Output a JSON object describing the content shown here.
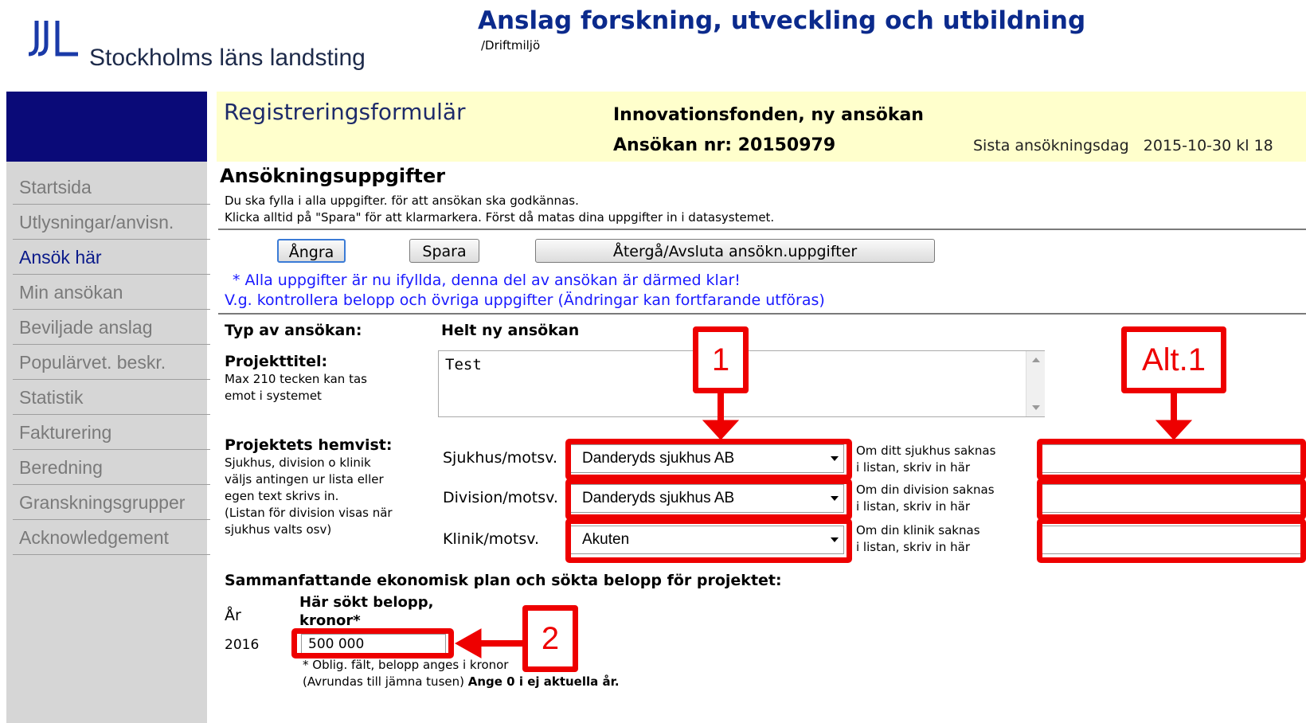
{
  "header": {
    "org_name": "Stockholms läns landsting",
    "app_title": "Anslag forskning, utveckling och utbildning",
    "environment": "/Driftmiljö"
  },
  "sidebar": {
    "items": [
      {
        "label": "Startsida"
      },
      {
        "label": "Utlysningar/anvisn."
      },
      {
        "label": "Ansök här",
        "active": true
      },
      {
        "label": "Min ansökan"
      },
      {
        "label": "Beviljade anslag"
      },
      {
        "label": "Populärvet. beskr."
      },
      {
        "label": "Statistik"
      },
      {
        "label": "Fakturering"
      },
      {
        "label": "Beredning"
      },
      {
        "label": "Granskningsgrupper"
      },
      {
        "label": "Acknowledgement"
      }
    ]
  },
  "band": {
    "form_title": "Registreringsformulär",
    "fund": "Innovationsfonden, ny ansökan",
    "application_nr": "Ansökan nr: 20150979",
    "deadline": "Sista ansökningsdag   2015-10-30 kl 18"
  },
  "section": {
    "title": "Ansökningsuppgifter",
    "instruction_1": "Du ska fylla i alla uppgifter. för att ansökan ska godkännas.",
    "instruction_2": "Klicka alltid på \"Spara\" för att klarmarkera. Först då matas dina uppgifter in i datasystemet."
  },
  "buttons": {
    "undo": "Ångra",
    "save": "Spara",
    "back": "Återgå/Avsluta ansökn.uppgifter"
  },
  "status": {
    "line_1": "* Alla uppgifter är nu ifyllda, denna del av ansökan är därmed klar!",
    "line_2": "V.g. kontrollera belopp och övriga uppgifter (Ändringar kan fortfarande utföras)"
  },
  "form": {
    "type_label": "Typ av ansökan:",
    "type_value": "Helt ny ansökan",
    "title_label": "Projekttitel:",
    "title_hint_1": "Max 210 tecken kan tas",
    "title_hint_2": "emot i systemet",
    "title_value": "Test",
    "home_label": "Projektets hemvist:",
    "home_hint_1": "Sjukhus, division o klinik",
    "home_hint_2": "väljs antingen ur lista eller",
    "home_hint_3": "egen text skrivs in.",
    "home_hint_4": "(Listan för division visas när",
    "home_hint_5": "sjukhus valts osv)",
    "hospital_label": "Sjukhus/motsv.",
    "hospital_value": "Danderyds sjukhus AB",
    "hospital_hint_1": "Om ditt sjukhus saknas",
    "hospital_hint_2": "i listan, skriv in här",
    "division_label": "Division/motsv.",
    "division_value": "Danderyds sjukhus AB",
    "division_hint_1": "Om din division saknas",
    "division_hint_2": "i listan, skriv in här",
    "clinic_label": "Klinik/motsv.",
    "clinic_value": "Akuten",
    "clinic_hint_1": "Om din klinik saknas",
    "clinic_hint_2": "i listan, skriv in här"
  },
  "economy": {
    "title": "Sammanfattande ekonomisk plan och sökta belopp för projektet:",
    "year_header": "År",
    "amount_header_1": "Här sökt belopp,",
    "amount_header_2": "kronor*",
    "year": "2016",
    "amount": "500 000",
    "note_1": "* Oblig. fält, belopp anges i kronor",
    "note_2_plain": "(Avrundas till jämna tusen) ",
    "note_2_bold": "Ange 0 i ej aktuella år."
  },
  "annotations": {
    "callout_1": "1",
    "callout_alt": "Alt.1",
    "callout_2": "2"
  },
  "colors": {
    "annotation_red": "#ee0000",
    "sidebar_head": "#0a0a78",
    "band_yellow": "#ffffcc",
    "title_blue": "#0b2a8c",
    "status_blue": "#1a1aff"
  }
}
